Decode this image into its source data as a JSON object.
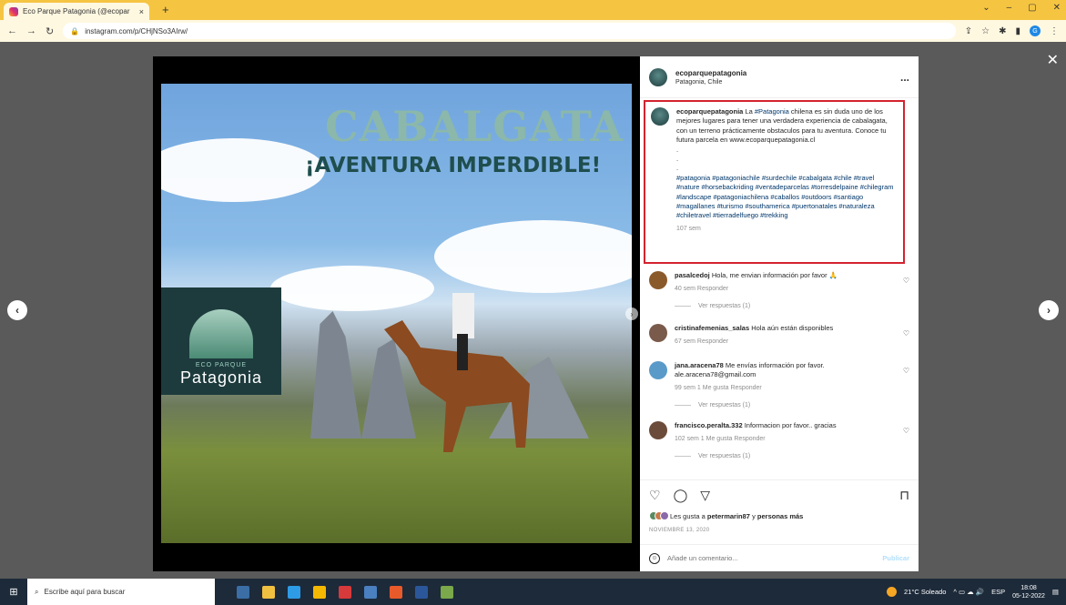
{
  "browser": {
    "tab_title": "Eco Parque Patagonia (@ecopar",
    "tab_close": "×",
    "new_tab": "+",
    "url": "instagram.com/p/CHjNSo3AIrw/",
    "profile_initial": "G"
  },
  "post": {
    "headline1": "CABALGATA",
    "headline2": "¡AVENTURA IMPERDIBLE!",
    "logo_small": "ECO PARQUE",
    "logo_big": "Patagonia"
  },
  "header": {
    "username": "ecoparquepatagonia",
    "location": "Patagonia, Chile",
    "more": "..."
  },
  "caption": {
    "username": "ecoparquepatagonia",
    "text_before_tag": " La ",
    "tag1": "#Patagonia",
    "text_after_tag": " chilena es sin duda uno de los mejores lugares para tener una verdadera experiencia de cabalagata, con un terreno prácticamente obstaculos para tu aventura. Conoce tu futura parcela en www.ecoparquepatagonia.cl",
    "dot1": ".",
    "dot2": ".",
    "dot3": ".",
    "hashtags": "#patagonia #patagoniachile #surdechile #cabalgata #chile #travel #nature #horsebackriding #ventadeparcelas #torresdelpaine #chilegram #landscape #patagoniachilena #caballos #outdoors #santiago #magallanes #turismo #southamerica #puertonatales #naturaleza #chiletravel #tierradelfuego #trekking",
    "time": "107 sem"
  },
  "comments": [
    {
      "user": "pasalcedoj",
      "text": " Hola, me envian información por favor 🙏",
      "meta": "40 sem   Responder",
      "replies": "Ver respuestas (1)"
    },
    {
      "user": "cristinafemenias_salas",
      "text": " Hola aún están disponibles",
      "meta": "67 sem   Responder",
      "replies": ""
    },
    {
      "user": "jana.aracena78",
      "text": " Me envías información por favor. ale.aracena78@gmail.com",
      "meta": "99 sem   1 Me gusta   Responder",
      "replies": "Ver respuestas (1)"
    },
    {
      "user": "francisco.peralta.332",
      "text": " Informacion por favor.. gracias",
      "meta": "102 sem   1 Me gusta   Responder",
      "replies": "Ver respuestas (1)"
    }
  ],
  "actions": {
    "likes_prefix": "Les gusta a ",
    "likes_user": "petermarin87",
    "likes_mid": " y ",
    "likes_others": "personas más",
    "date": "NOVIEMBRE 13, 2020",
    "comment_placeholder": "Añade un comentario...",
    "publish": "Publicar"
  },
  "taskbar": {
    "search_placeholder": "Escribe aquí para buscar",
    "weather": "21°C  Soleado",
    "lang": "ESP",
    "time": "18:08",
    "date": "05-12-2022"
  },
  "icons": [
    "instagram-favicon",
    "back-icon",
    "forward-icon",
    "reload-icon",
    "lock-icon",
    "share-icon",
    "star-icon",
    "extension-icon",
    "close-icon",
    "chevron-left-icon",
    "chevron-right-icon",
    "more-icon",
    "heart-icon",
    "comment-icon",
    "send-icon",
    "bookmark-icon",
    "emoji-icon",
    "windows-icon",
    "search-icon"
  ],
  "colors": {
    "highlight_border": "#d3232f",
    "link": "#00376b",
    "publish": "#b2dffc",
    "chrome": "#f5c542"
  }
}
